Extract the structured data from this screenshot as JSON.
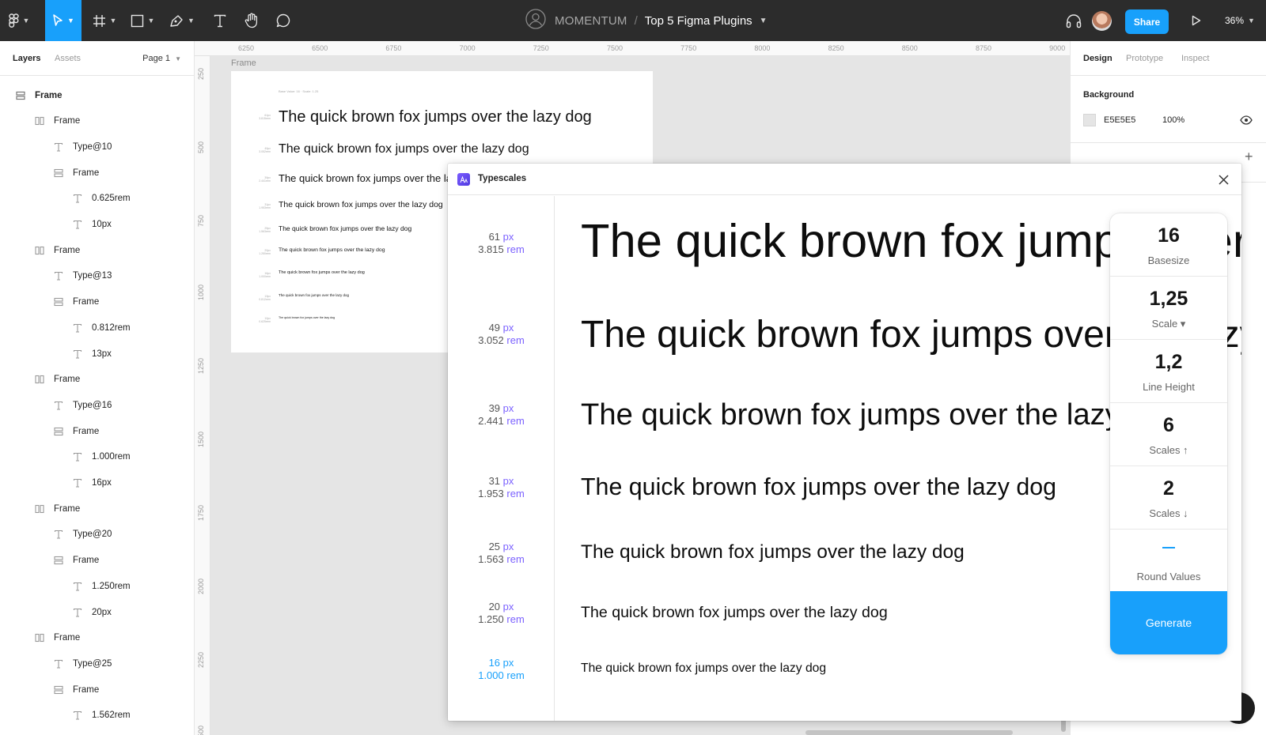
{
  "toolbar": {
    "team": "MOMENTUM",
    "separator": "/",
    "file_name": "Top 5 Figma Plugins",
    "share_label": "Share",
    "zoom": "36%",
    "icons": [
      "figma-menu-icon",
      "move-tool-icon",
      "frame-tool-icon",
      "shape-tool-icon",
      "pen-tool-icon",
      "text-tool-icon",
      "hand-tool-icon",
      "comment-tool-icon",
      "team-avatar-icon",
      "headphones-icon",
      "user-avatar",
      "present-play-icon"
    ]
  },
  "layers_panel": {
    "tab_layers": "Layers",
    "tab_assets": "Assets",
    "page": "Page 1",
    "items": [
      {
        "label": "Frame",
        "type": "frame",
        "indent": 0
      },
      {
        "label": "Frame",
        "type": "columns",
        "indent": 1
      },
      {
        "label": "Type@10",
        "type": "text",
        "indent": 2
      },
      {
        "label": "Frame",
        "type": "rows",
        "indent": 2
      },
      {
        "label": "0.625rem",
        "type": "text",
        "indent": 3
      },
      {
        "label": "10px",
        "type": "text",
        "indent": 3
      },
      {
        "label": "Frame",
        "type": "columns",
        "indent": 1
      },
      {
        "label": "Type@13",
        "type": "text",
        "indent": 2
      },
      {
        "label": "Frame",
        "type": "rows",
        "indent": 2
      },
      {
        "label": "0.812rem",
        "type": "text",
        "indent": 3
      },
      {
        "label": "13px",
        "type": "text",
        "indent": 3
      },
      {
        "label": "Frame",
        "type": "columns",
        "indent": 1
      },
      {
        "label": "Type@16",
        "type": "text",
        "indent": 2
      },
      {
        "label": "Frame",
        "type": "rows",
        "indent": 2
      },
      {
        "label": "1.000rem",
        "type": "text",
        "indent": 3
      },
      {
        "label": "16px",
        "type": "text",
        "indent": 3
      },
      {
        "label": "Frame",
        "type": "columns",
        "indent": 1
      },
      {
        "label": "Type@20",
        "type": "text",
        "indent": 2
      },
      {
        "label": "Frame",
        "type": "rows",
        "indent": 2
      },
      {
        "label": "1.250rem",
        "type": "text",
        "indent": 3
      },
      {
        "label": "20px",
        "type": "text",
        "indent": 3
      },
      {
        "label": "Frame",
        "type": "columns",
        "indent": 1
      },
      {
        "label": "Type@25",
        "type": "text",
        "indent": 2
      },
      {
        "label": "Frame",
        "type": "rows",
        "indent": 2
      },
      {
        "label": "1.562rem",
        "type": "text",
        "indent": 3
      }
    ]
  },
  "rulers": {
    "top": [
      "6250",
      "6500",
      "6750",
      "7000",
      "7250",
      "7500",
      "7750",
      "8000",
      "8250",
      "8500",
      "8750",
      "9000"
    ],
    "left": [
      "250",
      "500",
      "750",
      "1000",
      "1250",
      "1500",
      "1750",
      "2000",
      "2250",
      "2500"
    ]
  },
  "canvas": {
    "frame_label": "Frame",
    "frame_caption": "Base Value: 16 · Scale: 1.25",
    "sample_text": "The quick brown fox jumps over the lazy dog",
    "lines": [
      {
        "meta": "61px\n3.815rem",
        "size": 20
      },
      {
        "meta": "49px\n3.052rem",
        "size": 16
      },
      {
        "meta": "39px\n2.441rem",
        "size": 13
      },
      {
        "meta": "31px\n1.953rem",
        "size": 10.5
      },
      {
        "meta": "25px\n1.563rem",
        "size": 8.5
      },
      {
        "meta": "20px\n1.250rem",
        "size": 6.8
      },
      {
        "meta": "16px\n1.000rem",
        "size": 5.5
      },
      {
        "meta": "13px\n0.812rem",
        "size": 4.5
      },
      {
        "meta": "10px\n0.625rem",
        "size": 3.6
      }
    ]
  },
  "design_panel": {
    "tab_design": "Design",
    "tab_prototype": "Prototype",
    "tab_inspect": "Inspect",
    "background_title": "Background",
    "background_hex": "E5E5E5",
    "background_opacity": "100%",
    "background_color": "#E5E5E5"
  },
  "plugin": {
    "title": "Typescales",
    "sample_text": "The quick brown fox jumps over the lazy dog",
    "px_unit": "px",
    "rem_unit": "rem",
    "scales": [
      {
        "px": "61",
        "rem": "3.815",
        "size": 61,
        "base": false
      },
      {
        "px": "49",
        "rem": "3.052",
        "size": 49,
        "base": false
      },
      {
        "px": "39",
        "rem": "2.441",
        "size": 39,
        "base": false
      },
      {
        "px": "31",
        "rem": "1.953",
        "size": 31,
        "base": false
      },
      {
        "px": "25",
        "rem": "1.563",
        "size": 25,
        "base": false
      },
      {
        "px": "20",
        "rem": "1.250",
        "size": 20,
        "base": false
      },
      {
        "px": "16",
        "rem": "1.000",
        "size": 16,
        "base": true
      }
    ],
    "settings": {
      "basesize_value": "16",
      "basesize_label": "Basesize",
      "scale_value": "1,25",
      "scale_label": "Scale ▾",
      "line_height_value": "1,2",
      "line_height_label": "Line Height",
      "scales_up_value": "6",
      "scales_up_label": "Scales ↑",
      "scales_down_value": "2",
      "scales_down_label": "Scales ↓",
      "round_values_label": "Round Values",
      "generate_label": "Generate"
    },
    "accent_color": "#18A0FB",
    "unit_color": "#7B61FF"
  }
}
